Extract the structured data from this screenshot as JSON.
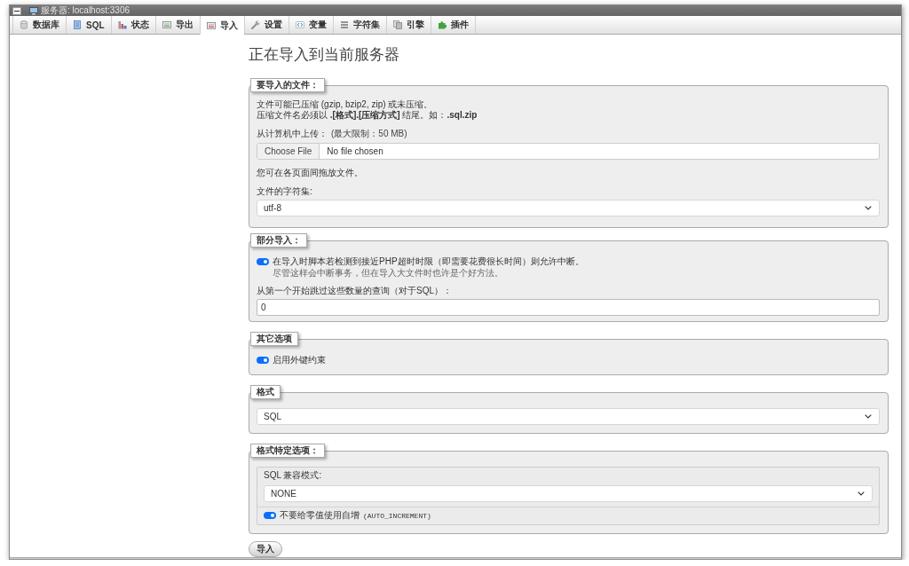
{
  "server_bar": {
    "title": "服务器: localhost:3306"
  },
  "tabs": [
    {
      "label": "数据库",
      "selected": false
    },
    {
      "label": "SQL",
      "selected": false
    },
    {
      "label": "状态",
      "selected": false
    },
    {
      "label": "导出",
      "selected": false
    },
    {
      "label": "导入",
      "selected": true
    },
    {
      "label": "设置",
      "selected": false
    },
    {
      "label": "变量",
      "selected": false
    },
    {
      "label": "字符集",
      "selected": false
    },
    {
      "label": "引擎",
      "selected": false
    },
    {
      "label": "插件",
      "selected": false
    }
  ],
  "page_title": "正在导入到当前服务器",
  "file_section": {
    "legend": "要导入的文件：",
    "notes": [
      "文件可能已压缩 (gzip, bzip2, zip) 或未压缩。",
      "压缩文件名必须以 **.[格式].[压缩方式]** 结尾。如：**.sql.zip**"
    ],
    "upload_label": "从计算机中上传：",
    "upload_limit": "(最大限制：50 MB)",
    "file_button": "Choose File",
    "file_status": "No file chosen",
    "drag_hint": "您可在各页面间拖放文件。",
    "charset_label": "文件的字符集:",
    "charset_value": "utf-8"
  },
  "partial_import": {
    "legend": "部分导入：",
    "allow_interrupt": {
      "label": "在导入时脚本若检测到接近PHP超时时限（即需要花费很长时间）则允许中断。",
      "hint": "尽管这样会中断事务，但在导入大文件时也许是个好方法。",
      "on": true
    },
    "skip_label": "从第一个开始跳过这些数量的查询（对于SQL）：",
    "skip_value": "0"
  },
  "other_options": {
    "legend": "其它选项",
    "foreign_key_checks": {
      "label": "启用外键约束",
      "on": true
    }
  },
  "format": {
    "legend": "格式",
    "value": "SQL"
  },
  "format_options": {
    "legend": "格式特定选项：",
    "compat_label": "SQL 兼容模式:",
    "compat_value": "NONE",
    "no_auto_value": {
      "label": "不要给零值使用自增",
      "code": "(AUTO_INCREMENT)",
      "on": true
    }
  },
  "submit_button": "导入"
}
